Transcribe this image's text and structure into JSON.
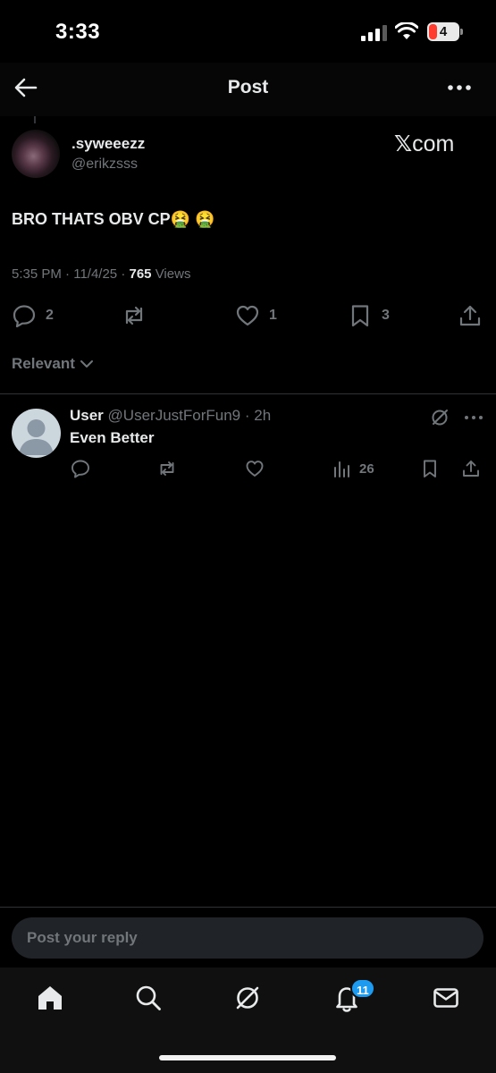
{
  "status_bar": {
    "time": "3:33",
    "battery_level": "4",
    "icons": [
      "cellular-signal-icon",
      "wifi-icon",
      "battery-icon"
    ]
  },
  "navbar": {
    "title": "Post",
    "icons": [
      "back-arrow-icon",
      "more-dots-icon"
    ]
  },
  "post": {
    "display_name": ".syweeezz",
    "handle": "@erikzsss",
    "watermark": "com",
    "watermark_icon": "x-logo-icon",
    "text": "BRO THATS OBV CP",
    "emoji": "🤮 🤮",
    "time": "5:35 PM",
    "date": "11/4/25",
    "views_count": "765",
    "views_label": "Views",
    "actions": {
      "replies": "2",
      "reposts": "",
      "likes": "1",
      "bookmarks": "3"
    }
  },
  "sort": {
    "label": "Relevant",
    "icon": "chevron-down-icon"
  },
  "reply": {
    "name": "User",
    "handle": "@UserJustForFun9",
    "time": "2h",
    "text": "Even Better",
    "views": "26"
  },
  "composer": {
    "placeholder": "Post your reply"
  },
  "tabbar": {
    "items": [
      "home-icon",
      "search-icon",
      "grok-icon",
      "notifications-icon",
      "messages-icon"
    ],
    "notification_badge": "11"
  },
  "colors": {
    "background": "#000000",
    "text": "#e7e9ea",
    "muted": "#71767b",
    "accent": "#1d9bf0",
    "divider": "#2f3336"
  }
}
